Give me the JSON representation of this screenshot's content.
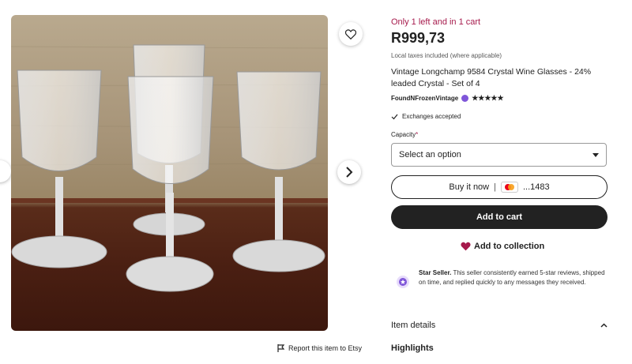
{
  "listing": {
    "stock_notice": "Only 1 left and in 1 cart",
    "price": "R999,73",
    "tax_note": "Local taxes included (where applicable)",
    "title": "Vintage Longchamp 9584 Crystal Wine Glasses - 24% leaded Crystal - Set of 4",
    "shop_name": "FoundNFrozenVintage",
    "rating_stars": "★★★★★",
    "exchanges": "Exchanges accepted"
  },
  "options": {
    "capacity_label": "Capacity",
    "required_mark": "*",
    "capacity_selected": "Select an option"
  },
  "actions": {
    "buy_now_label": "Buy it now",
    "buy_now_separator": "|",
    "card_digits": "...1483",
    "add_to_cart": "Add to cart",
    "add_to_collection": "Add to collection",
    "report": "Report this item to Etsy"
  },
  "seller": {
    "badge": "Star Seller.",
    "text": "This seller consistently earned 5-star reviews, shipped on time, and replied quickly to any messages they received."
  },
  "sections": {
    "item_details": "Item details",
    "highlights": "Highlights"
  },
  "colors": {
    "accent": "#a61a4c",
    "button_dark": "#222222",
    "star_seller": "#7f56d9"
  },
  "icons": {
    "favorite": "heart-icon",
    "next": "chevron-right-icon",
    "report": "flag-icon",
    "exchanges": "check-icon",
    "dropdown": "caret-down-icon",
    "collection": "heart-filled-icon",
    "star_seller": "star-badge-icon",
    "expand": "chevron-up-icon"
  }
}
